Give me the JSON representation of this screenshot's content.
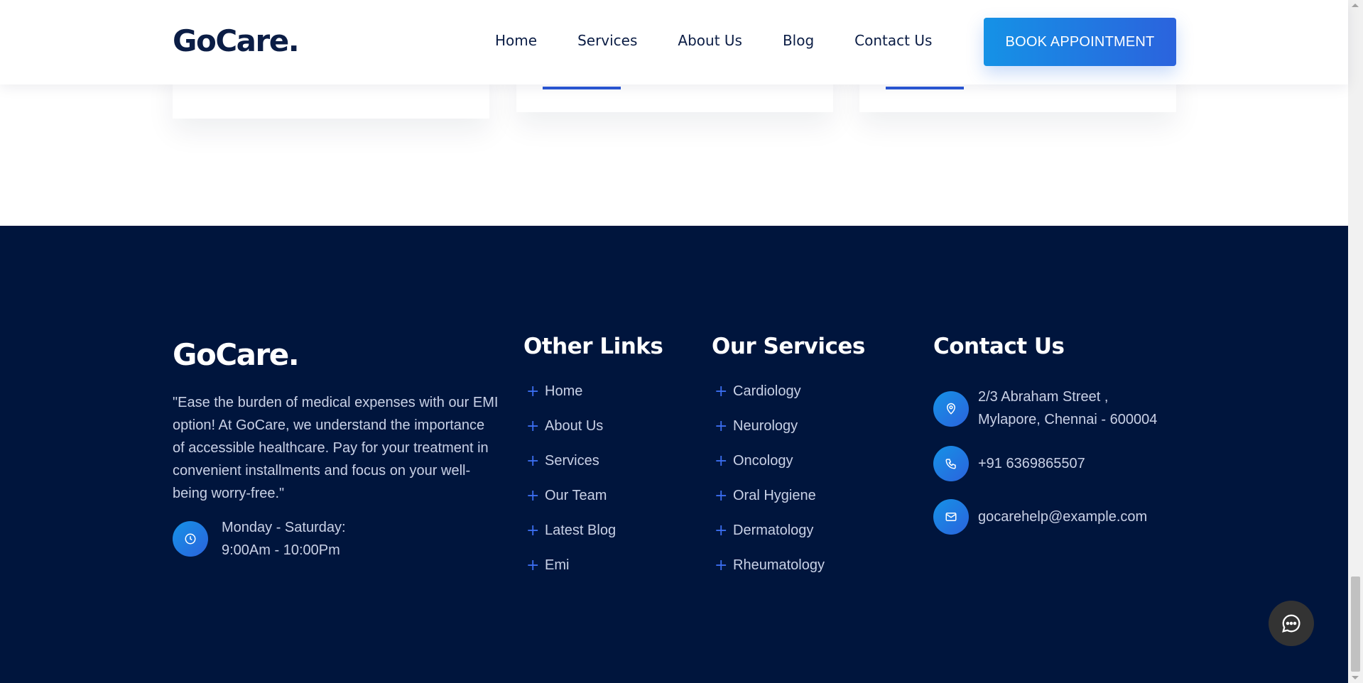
{
  "header": {
    "logo": "GoCare.",
    "nav": [
      "Home",
      "Services",
      "About Us",
      "Blog",
      "Contact Us"
    ],
    "cta": "BOOK APPOINTMENT"
  },
  "footer": {
    "logo": "GoCare.",
    "about": "\"Ease the burden of medical expenses with our EMI option! At GoCare, we understand the importance of accessible healthcare. Pay for your treatment in convenient installments and focus on your well-being worry-free.\"",
    "hours": {
      "days": "Monday - Saturday:",
      "time": "9:00Am - 10:00Pm",
      "icon": "clock-icon"
    },
    "other_links": {
      "title": "Other Links",
      "items": [
        "Home",
        "About Us",
        "Services",
        "Our Team",
        "Latest Blog",
        "Emi"
      ]
    },
    "services": {
      "title": "Our Services",
      "items": [
        "Cardiology",
        "Neurology",
        "Oncology",
        "Oral Hygiene",
        "Dermatology",
        "Rheumatology"
      ]
    },
    "contact": {
      "title": "Contact Us",
      "address_line1": "2/3 Abraham Street ,",
      "address_line2": "Mylapore, Chennai - 600004",
      "phone": "+91 6369865507",
      "email": "gocarehelp@example.com"
    }
  },
  "colors": {
    "footer_bg": "#00153d",
    "accent": "#2b63dd",
    "accent_light": "#1592e6",
    "navy": "#0b1d45",
    "chat_bg": "#333333"
  },
  "icons": {
    "list_bullet": "plus-icon",
    "address": "map-pin-icon",
    "phone": "phone-icon",
    "email": "mail-icon",
    "chat": "chat-bubble-icon"
  }
}
